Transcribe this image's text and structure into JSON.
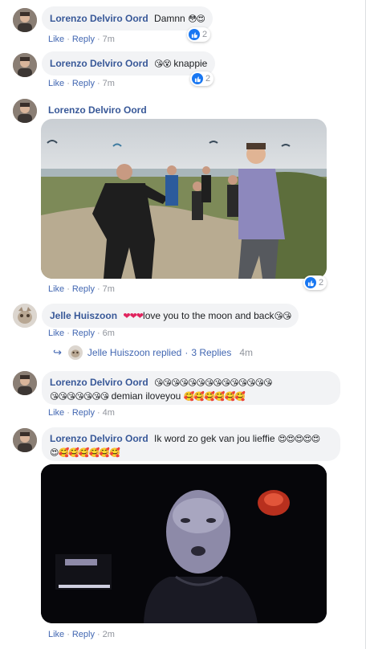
{
  "comments": [
    {
      "author": "Lorenzo Delviro Oord",
      "text": "Damnn",
      "emojis": "😳😍",
      "actions": {
        "like": "Like",
        "reply": "Reply",
        "time": "7m"
      },
      "reactions": 2
    },
    {
      "author": "Lorenzo Delviro Oord",
      "text": "knappie",
      "emojis": "😘😵",
      "actions": {
        "like": "Like",
        "reply": "Reply",
        "time": "7m"
      },
      "reactions": 2
    },
    {
      "author": "Lorenzo Delviro Oord",
      "text": "",
      "media": "video",
      "actions": {
        "like": "Like",
        "reply": "Reply",
        "time": "7m"
      },
      "reactions": 2
    },
    {
      "author": "Jelle Huiszoon",
      "emojis_before": "❤❤❤",
      "text": "love you to the moon and back",
      "emojis_after": "😘😘",
      "actions": {
        "like": "Like",
        "reply": "Reply",
        "time": "6m"
      }
    },
    {
      "author": "Lorenzo Delviro Oord",
      "emojis_line1": "😘😘😘😘😘😘😘😘😘😘😘😘😘😘",
      "emojis_line2": "😘😘😘😘😘😘😘",
      "text": "demian iloveyou",
      "emojis_after": "🥰🥰🥰🥰🥰🥰",
      "actions": {
        "like": "Like",
        "reply": "Reply",
        "time": "4m"
      }
    },
    {
      "author": "Lorenzo Delviro Oord",
      "text": "Ik word zo gek van jou lieffie",
      "emojis_after": "😍😍😍😍😍",
      "emojis_line2": "😍🥰🥰🥰🥰🥰🥰",
      "media": "photo",
      "actions": {
        "like": "Like",
        "reply": "Reply",
        "time": "2m"
      }
    }
  ],
  "replied": {
    "name": "Jelle Huiszoon",
    "label": "replied",
    "separator": "·",
    "count": "3 Replies",
    "time": "4m"
  },
  "colors": {
    "author": "#385898",
    "link": "#4267b2",
    "meta": "#90949c",
    "bubble": "#f2f3f5",
    "reaction": "#1877f2"
  },
  "icons": {
    "like": "like-thumb-icon",
    "reply_arrow": "reply-arrow-icon"
  }
}
